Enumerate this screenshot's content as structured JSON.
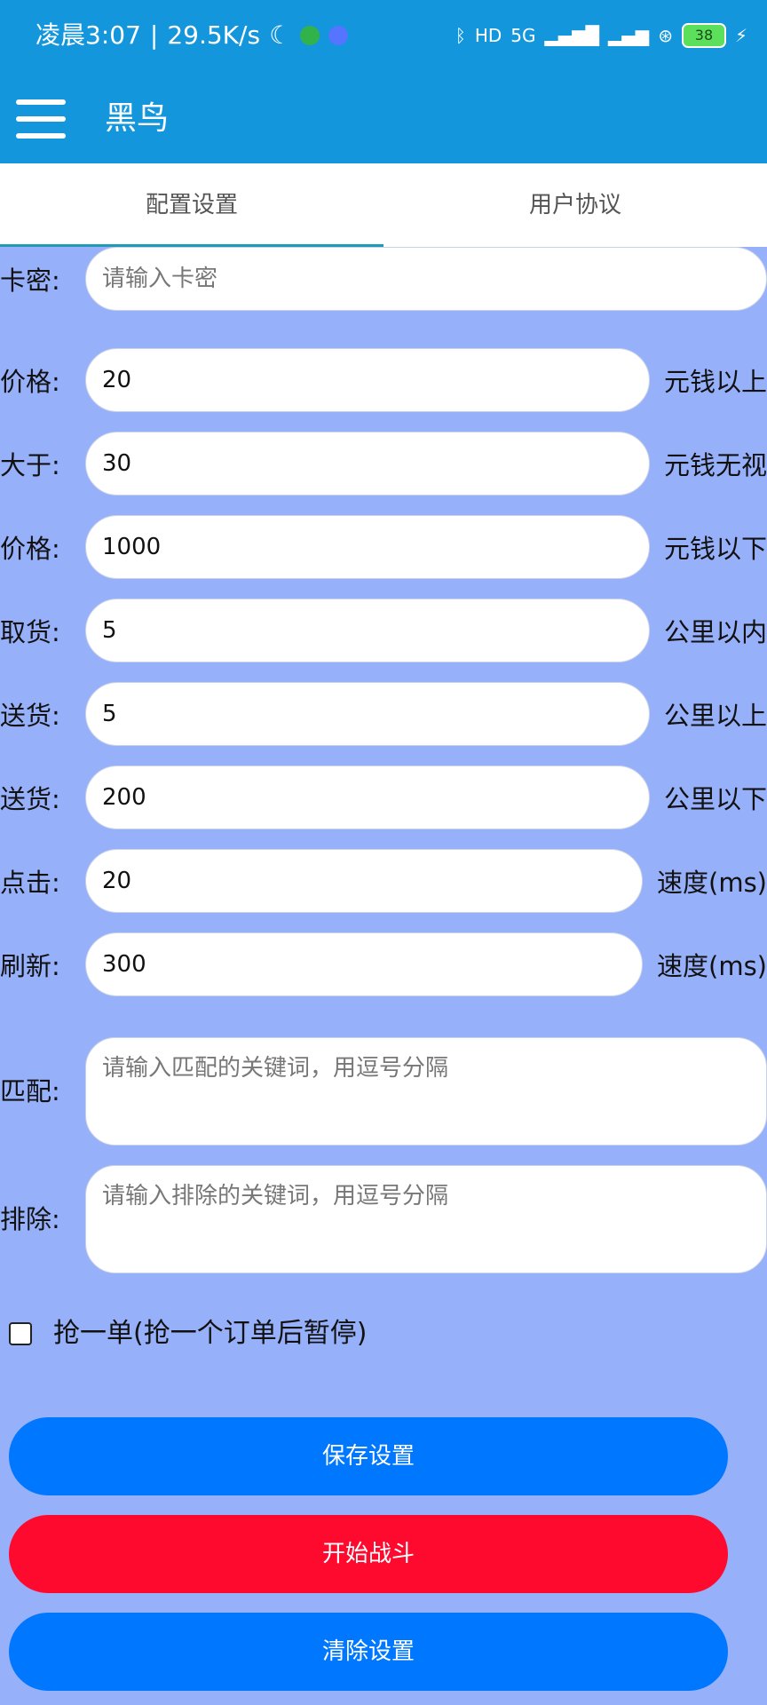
{
  "status": {
    "time": "凌晨3:07",
    "network_speed": "29.5K/s",
    "hd_label": "HD",
    "signal_label": "5G",
    "battery": "38"
  },
  "app": {
    "title": "黑鸟"
  },
  "tabs": [
    {
      "label": "配置设置"
    },
    {
      "label": "用户协议"
    }
  ],
  "form": {
    "card_label": "卡密:",
    "card_placeholder": "请输入卡密",
    "rows": [
      {
        "label": "价格:",
        "value": "20",
        "suffix": "元钱以上"
      },
      {
        "label": "大于:",
        "value": "30",
        "suffix": "元钱无视"
      },
      {
        "label": "价格:",
        "value": "1000",
        "suffix": "元钱以下"
      },
      {
        "label": "取货:",
        "value": "5",
        "suffix": "公里以内"
      },
      {
        "label": "送货:",
        "value": "5",
        "suffix": "公里以上"
      },
      {
        "label": "送货:",
        "value": "200",
        "suffix": "公里以下"
      },
      {
        "label": "点击:",
        "value": "20",
        "suffix": "速度(ms)"
      },
      {
        "label": "刷新:",
        "value": "300",
        "suffix": "速度(ms)"
      }
    ],
    "match_label": "匹配:",
    "match_placeholder": "请输入匹配的关键词，用逗号分隔",
    "exclude_label": "排除:",
    "exclude_placeholder": "请输入排除的关键词，用逗号分隔",
    "grab_one_label": "抢一单(抢一个订单后暂停)"
  },
  "buttons": {
    "save": "保存设置",
    "start": "开始战斗",
    "clear": "清除设置"
  },
  "colors": {
    "topbar": "#1496dc",
    "background": "#97b0fa",
    "primary_button": "#0077ff",
    "danger_button": "#ff0a2f"
  }
}
